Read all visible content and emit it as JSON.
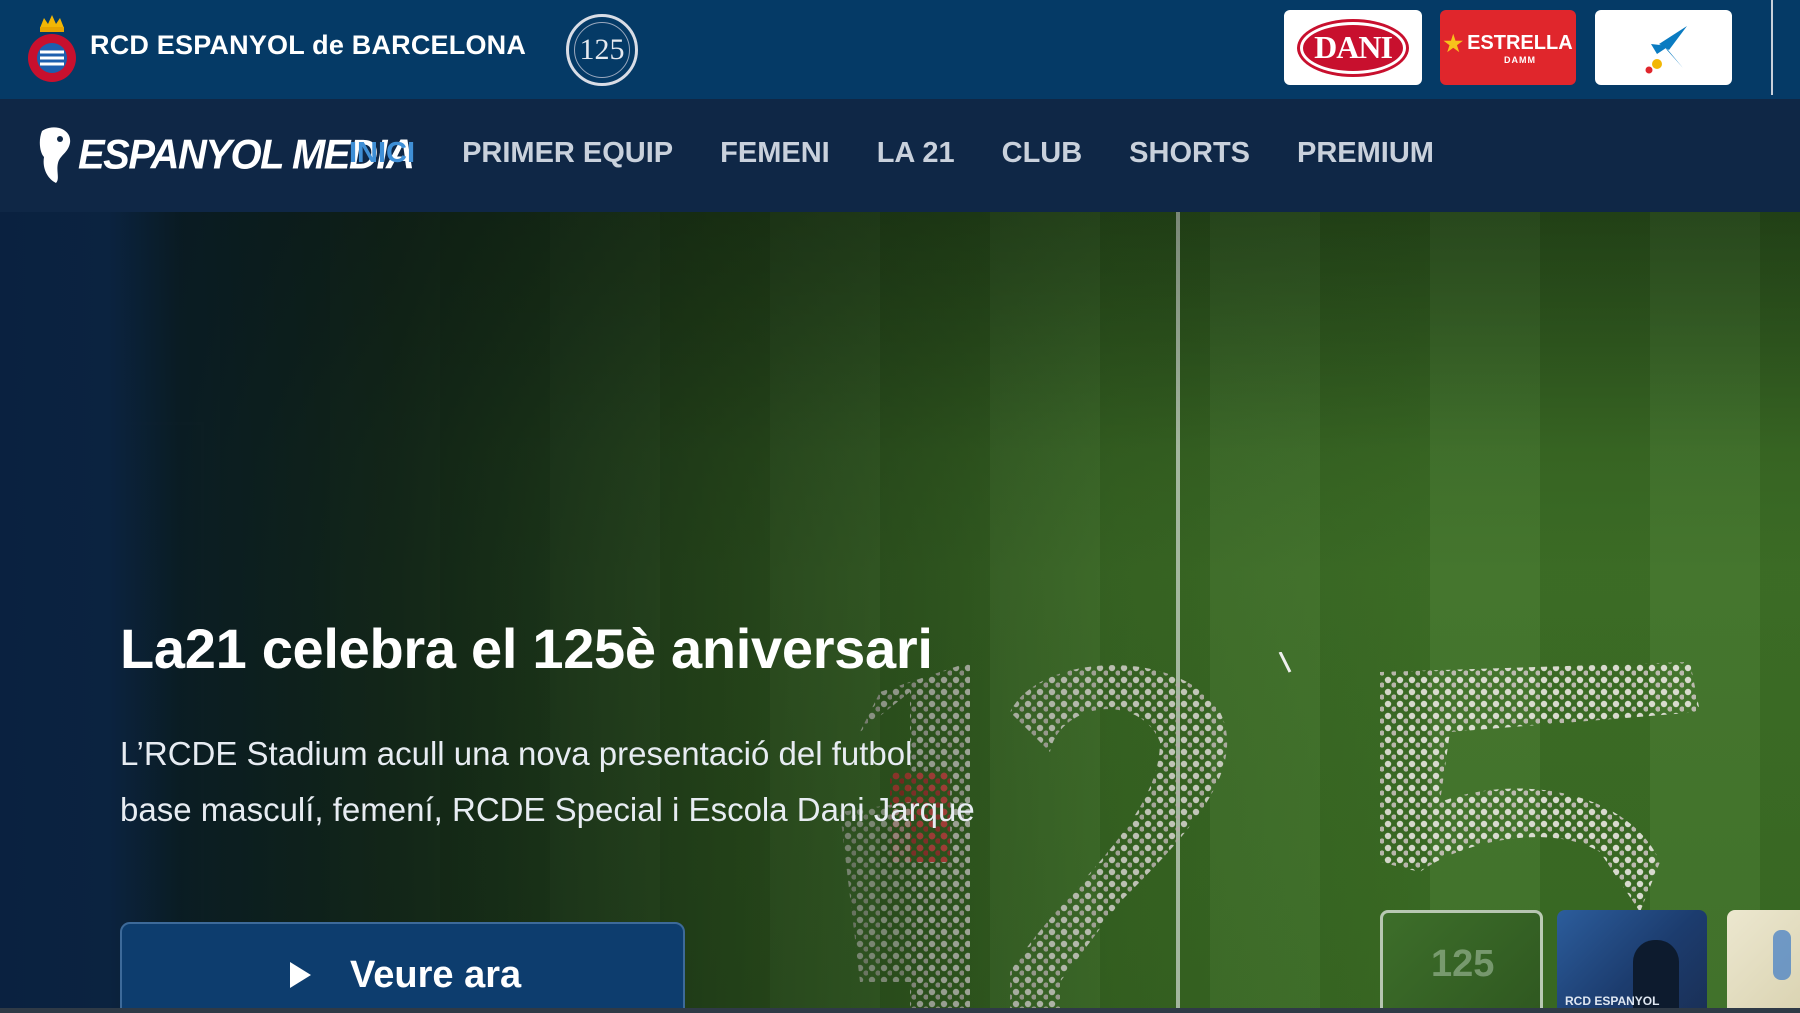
{
  "header": {
    "club_name": "RCD ESPANYOL de BARCELONA",
    "anniversary_badge": "125",
    "sponsors": [
      {
        "name": "DANI",
        "color": "#c8102e"
      },
      {
        "name": "ESTRELLA",
        "sub": "DAMM",
        "color": "#e0262c"
      },
      {
        "name": "CaixaBank",
        "color": "#0a7bc1"
      }
    ]
  },
  "nav": {
    "brand": "ESPANYOL MEDIA",
    "items": [
      {
        "label": "INICI",
        "active": true
      },
      {
        "label": "PRIMER EQUIP",
        "active": false
      },
      {
        "label": "FEMENI",
        "active": false
      },
      {
        "label": "LA 21",
        "active": false
      },
      {
        "label": "CLUB",
        "active": false
      },
      {
        "label": "SHORTS",
        "active": false
      },
      {
        "label": "PREMIUM",
        "active": false
      }
    ],
    "active_color": "#3f8fd6"
  },
  "hero": {
    "title": "La21 celebra el 125è aniversari",
    "description": "L’RCDE Stadium acull una nova presentació del futbol base masculí, femení, RCDE Special i Escola Dani Jarque",
    "watch_button": "Veure ara",
    "crowd_number": "125",
    "thumbnails": [
      {
        "label": "125",
        "selected": true
      },
      {
        "label": "RCD ESPANYOL",
        "selected": false
      },
      {
        "label": "",
        "selected": false
      }
    ]
  },
  "colors": {
    "topbar": "#053a66",
    "navbar": "#0f2746",
    "button": "#0d3d6e"
  }
}
